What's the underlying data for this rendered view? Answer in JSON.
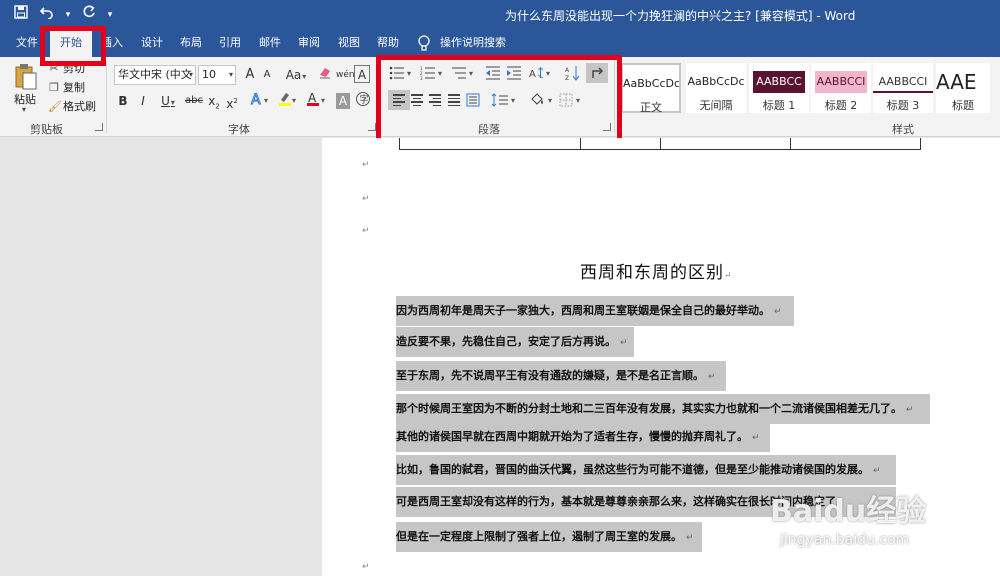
{
  "window": {
    "title": "为什么东周没能出现一个力挽狂澜的中兴之主? [兼容模式] - Word"
  },
  "quick_access": {
    "save_icon": "save-icon",
    "undo_icon": "undo-icon",
    "redo_icon": "redo-icon",
    "customize_icon": "customize-qat-icon"
  },
  "tabs": [
    {
      "label": "文件"
    },
    {
      "label": "开始"
    },
    {
      "label": "插入"
    },
    {
      "label": "设计"
    },
    {
      "label": "布局"
    },
    {
      "label": "引用"
    },
    {
      "label": "邮件"
    },
    {
      "label": "审阅"
    },
    {
      "label": "视图"
    },
    {
      "label": "帮助"
    }
  ],
  "tell_me": "操作说明搜索",
  "clipboard": {
    "group_label": "剪贴板",
    "paste": "粘贴",
    "cut": "剪切",
    "copy": "复制",
    "format_painter": "格式刷"
  },
  "font": {
    "group_label": "字体",
    "font_name": "华文中宋 (中文",
    "font_size": "10",
    "grow": "A",
    "shrink": "A",
    "change_case": "Aa",
    "bold": "B",
    "italic": "I",
    "underline": "U",
    "strike": "abc",
    "subscript": "x",
    "superscript": "x",
    "font_color": "A",
    "shading": "A",
    "char_border": "A"
  },
  "paragraph": {
    "group_label": "段落"
  },
  "styles": {
    "group_label": "样式",
    "items": [
      {
        "sample": "AaBbCcDc",
        "name": "正文"
      },
      {
        "sample": "AaBbCcDc",
        "name": "无间隔"
      },
      {
        "sample": "AABBCC",
        "name": "标题 1"
      },
      {
        "sample": "AABBCCI",
        "name": "标题 2"
      },
      {
        "sample": "AABBCCI",
        "name": "标题 3"
      },
      {
        "sample": "AAE",
        "name": "标题"
      }
    ]
  },
  "document": {
    "heading": "西周和东周的区别",
    "paragraphs": [
      "因为西周初年是周天子一家独大，西周和周王室联姻是保全自己的最好举动。",
      "造反要不果，先稳住自己，安定了后方再说。",
      "至于东周，先不说周平王有没有通敌的嫌疑，是不是名正言顺。",
      "那个时候周王室因为不断的分封土地和二三百年没有发展，其实实力也就和一个二流诸侯国相差无几了。",
      "其他的诸侯国早就在西周中期就开始为了适者生存，慢慢的抛弃周礼了。",
      "比如，鲁国的弑君，晋国的曲沃代翼，虽然这些行为可能不道德，但是至少能推动诸侯国的发展。",
      "可是西周王室却没有这样的行为，基本就是尊尊亲亲那么来，这样确实在很长时间内稳定了",
      "但是在一定程度上限制了强者上位，遏制了周王室的发展。"
    ]
  },
  "watermark": {
    "logo": "Baidu经验",
    "url": "jingyan.baidu.com"
  },
  "colors": {
    "brand": "#2b579a",
    "highlight": "#e3001b",
    "selection": "#c6c6c6"
  }
}
